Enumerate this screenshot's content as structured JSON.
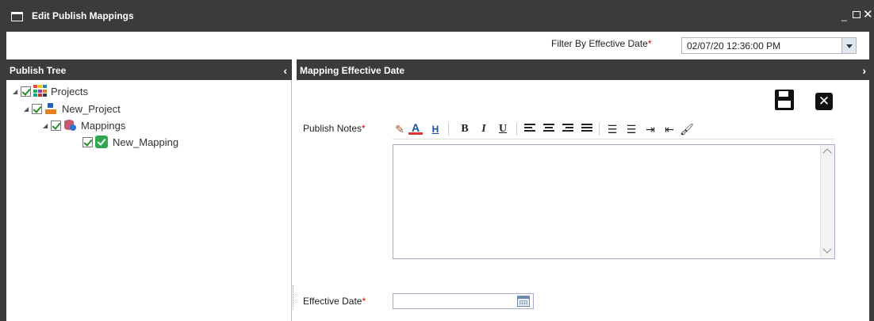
{
  "window": {
    "title": "Edit Publish Mappings",
    "controls": {
      "minimize": "_",
      "close": "✕"
    }
  },
  "filter": {
    "label": "Filter By Effective Date",
    "required_mark": "*",
    "value": "02/07/20 12:36:00 PM"
  },
  "left_panel": {
    "title": "Publish Tree",
    "collapse_glyph": "‹",
    "tree": [
      {
        "label": "Projects",
        "icon": "projects-icon",
        "checked": true,
        "expanded": true
      },
      {
        "label": "New_Project",
        "icon": "project-icon",
        "checked": true,
        "expanded": true
      },
      {
        "label": "Mappings",
        "icon": "mappings-icon",
        "checked": true,
        "expanded": true
      },
      {
        "label": "New_Mapping",
        "icon": "mapping-icon",
        "checked": true
      }
    ]
  },
  "right_panel": {
    "title": "Mapping Effective Date",
    "expand_glyph": "›",
    "close_glyph": "✕",
    "publish_notes_label": "Publish Notes",
    "effective_date_label": "Effective Date",
    "required_mark": "*",
    "publish_notes_value": "",
    "effective_date_value": "",
    "toolbar": {
      "font_color": "A",
      "highlight": "H",
      "bold": "B",
      "italic": "I",
      "underline": "U"
    }
  },
  "colors": {
    "title_bar": "#3b3b3b",
    "required": "#cc0000",
    "check": "#2a8a2a"
  }
}
